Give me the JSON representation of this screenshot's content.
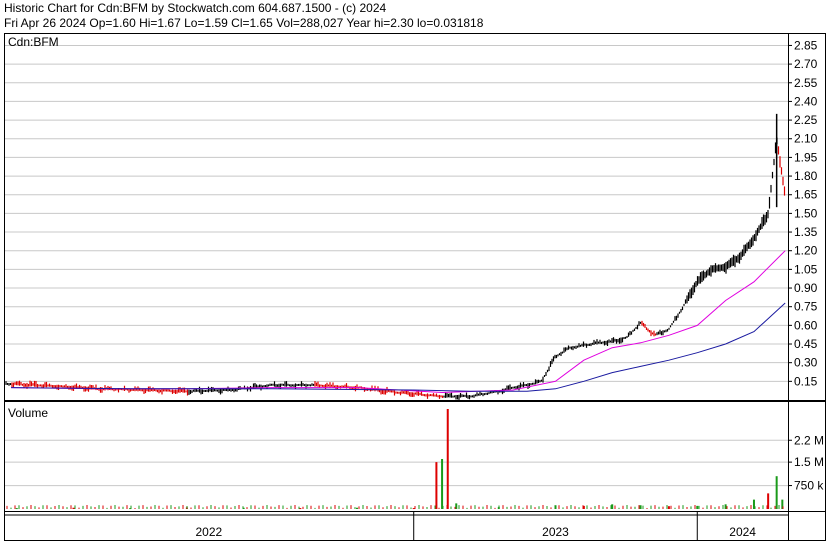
{
  "header": {
    "line1": "Historic Chart for Cdn:BFM by Stockwatch.com 604.687.1500 - (c) 2024",
    "line2": "Fri Apr 26 2024  Op=1.60  Hi=1.67  Lo=1.59  Cl=1.65  Vol=288,027  Year hi=2.30  lo=0.031818"
  },
  "colors": {
    "up": "#000000",
    "down": "#dd0000",
    "ma_short": "#e000e0",
    "ma_long": "#1a1aa0",
    "vol_up": "#1a9a1a",
    "vol_down": "#dd0000",
    "grid": "#c8c8c8"
  },
  "chart_data": [
    {
      "type": "line",
      "panel": "price",
      "symbol_label": "Cdn:BFM",
      "ylim": [
        0,
        2.95
      ],
      "y_ticks": [
        "2.85",
        "2.70",
        "2.55",
        "2.40",
        "2.25",
        "2.10",
        "1.95",
        "1.80",
        "1.65",
        "1.50",
        "1.35",
        "1.20",
        "1.05",
        "0.90",
        "0.75",
        "0.60",
        "0.45",
        "0.30",
        "0.15"
      ],
      "x_labels": [
        "2022",
        "2023",
        "2024"
      ],
      "series": [
        {
          "role": "price",
          "x": [
            2021.58,
            2021.75,
            2021.9,
            2022.05,
            2022.2,
            2022.35,
            2022.5,
            2022.65,
            2022.8,
            2022.95,
            2023.1,
            2023.2,
            2023.3,
            2023.35,
            2023.4,
            2023.45,
            2023.5,
            2023.55,
            2023.6,
            2023.65,
            2023.7,
            2023.75,
            2023.8,
            2023.85,
            2023.9,
            2023.95,
            2024.0,
            2024.05,
            2024.1,
            2024.15,
            2024.2,
            2024.25,
            2024.28,
            2024.31
          ],
          "values": [
            0.13,
            0.11,
            0.09,
            0.08,
            0.07,
            0.08,
            0.12,
            0.12,
            0.1,
            0.06,
            0.03,
            0.03,
            0.07,
            0.1,
            0.12,
            0.15,
            0.35,
            0.42,
            0.44,
            0.46,
            0.47,
            0.5,
            0.62,
            0.52,
            0.57,
            0.75,
            0.95,
            1.05,
            1.07,
            1.15,
            1.3,
            1.5,
            2.1,
            1.65
          ]
        },
        {
          "role": "moving-average-short",
          "x": [
            2021.58,
            2021.9,
            2022.2,
            2022.5,
            2022.8,
            2023.1,
            2023.35,
            2023.5,
            2023.6,
            2023.7,
            2023.8,
            2023.9,
            2024.0,
            2024.1,
            2024.2,
            2024.31
          ],
          "values": [
            0.1,
            0.09,
            0.09,
            0.1,
            0.1,
            0.06,
            0.08,
            0.15,
            0.32,
            0.42,
            0.46,
            0.52,
            0.6,
            0.8,
            0.95,
            1.2
          ]
        },
        {
          "role": "moving-average-long",
          "x": [
            2021.58,
            2022.0,
            2022.5,
            2023.0,
            2023.2,
            2023.4,
            2023.5,
            2023.6,
            2023.7,
            2023.8,
            2023.9,
            2024.0,
            2024.1,
            2024.2,
            2024.31
          ],
          "values": [
            0.1,
            0.09,
            0.09,
            0.08,
            0.07,
            0.07,
            0.09,
            0.15,
            0.22,
            0.27,
            0.32,
            0.38,
            0.45,
            0.55,
            0.78
          ]
        }
      ]
    },
    {
      "type": "bar",
      "panel": "volume",
      "title": "Volume",
      "ylim": [
        0,
        3200000
      ],
      "y_ticks": [
        "2.2 M",
        "1.5 M",
        "750 k"
      ],
      "x": [
        2021.6,
        2021.8,
        2022.0,
        2022.2,
        2022.4,
        2022.6,
        2022.8,
        2023.0,
        2023.08,
        2023.1,
        2023.12,
        2023.15,
        2023.3,
        2023.5,
        2023.6,
        2023.7,
        2023.8,
        2023.9,
        2024.0,
        2024.1,
        2024.2,
        2024.25,
        2024.28,
        2024.3
      ],
      "values": [
        30000,
        40000,
        30000,
        50000,
        40000,
        30000,
        40000,
        30000,
        1500000,
        1600000,
        3200000,
        180000,
        60000,
        120000,
        100000,
        150000,
        120000,
        90000,
        100000,
        150000,
        300000,
        500000,
        1050000,
        300000
      ],
      "direction": [
        "up",
        "down",
        "up",
        "down",
        "up",
        "down",
        "up",
        "down",
        "down",
        "up",
        "down",
        "up",
        "up",
        "up",
        "down",
        "up",
        "up",
        "down",
        "up",
        "up",
        "up",
        "down",
        "up",
        "up"
      ]
    }
  ]
}
